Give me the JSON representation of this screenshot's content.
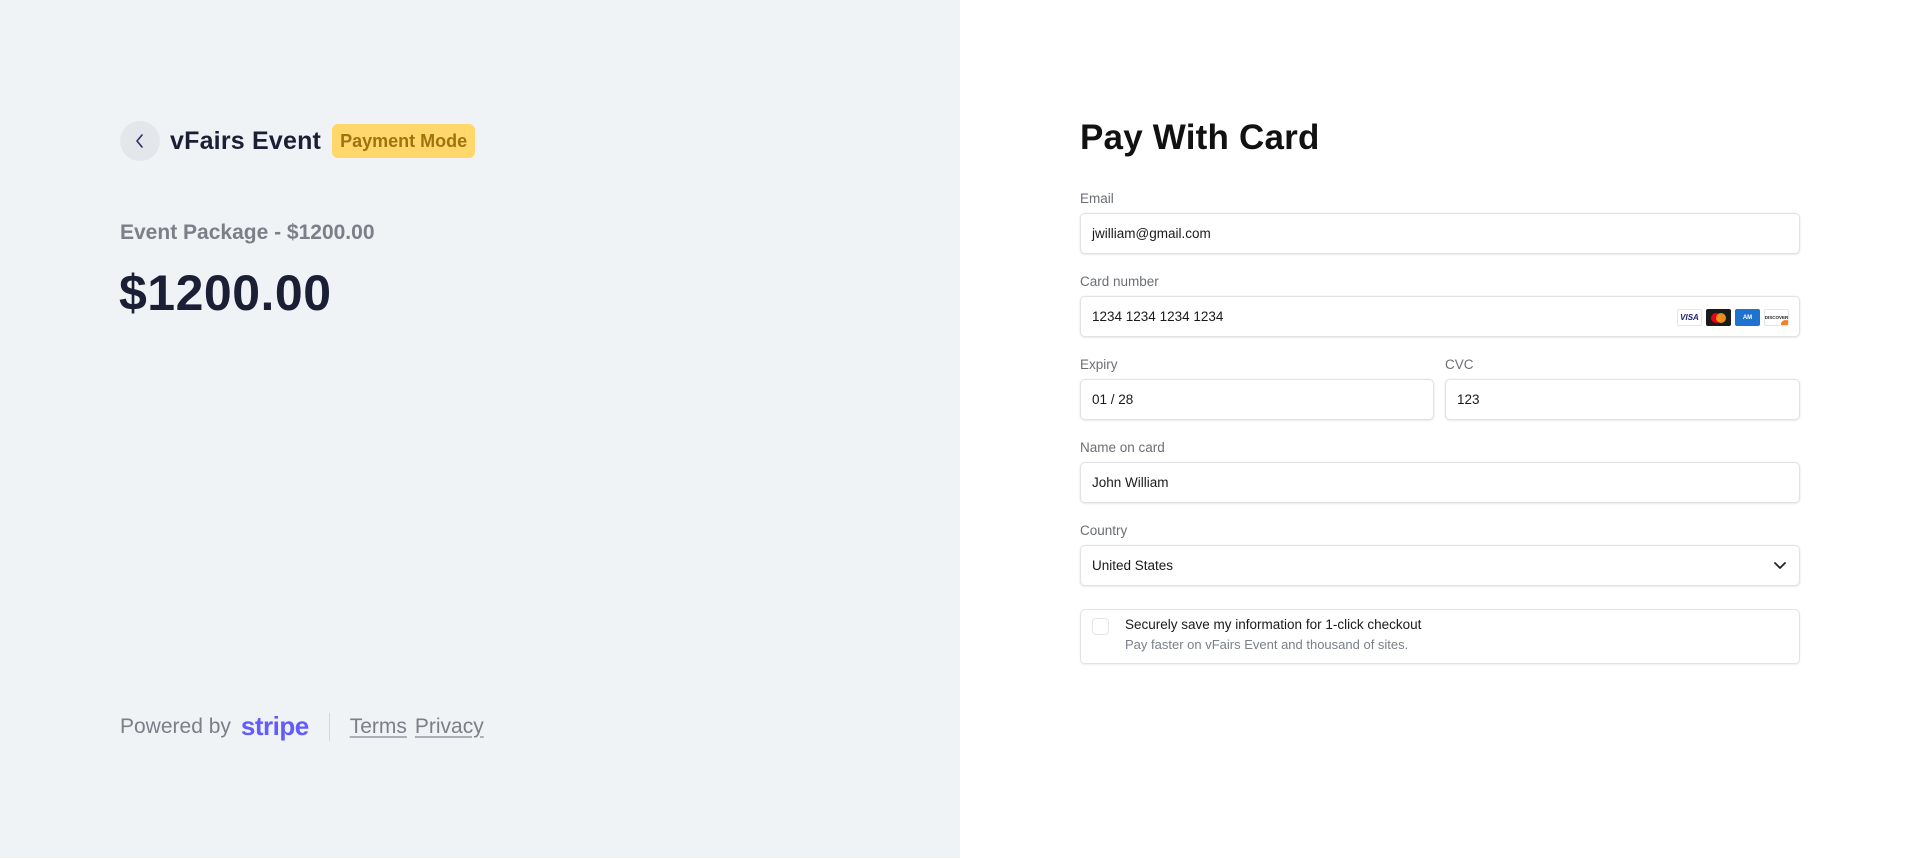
{
  "summary": {
    "back_icon": "chevron-left-icon",
    "brand_name": "vFairs Event",
    "mode_badge": "Payment Mode",
    "package_label": "Event Package - $1200.00",
    "total_amount": "$1200.00",
    "footer": {
      "powered_by": "Powered by",
      "stripe_logo": "stripe",
      "terms": "Terms",
      "privacy": "Privacy"
    },
    "colors": {
      "badge_bg": "#ffd76a",
      "badge_text": "#a07212",
      "stripe": "#635bff",
      "panel_bg": "#f0f3f6"
    }
  },
  "form": {
    "title": "Pay With Card",
    "email": {
      "label": "Email",
      "value": "jwilliam@gmail.com"
    },
    "card_number": {
      "label": "Card number",
      "value": "1234 1234 1234 1234",
      "brands": [
        "VISA",
        "Mastercard",
        "American Express",
        "Discover"
      ]
    },
    "expiry": {
      "label": "Expiry",
      "value": "01 / 28"
    },
    "cvc": {
      "label": "CVC",
      "value": "123"
    },
    "name": {
      "label": "Name on card",
      "value": "John William"
    },
    "country": {
      "label": "Country",
      "value": "United States"
    },
    "save_info": {
      "checked": false,
      "title": "Securely save my information for 1-click checkout",
      "subtitle": "Pay faster on vFairs Event and thousand of sites."
    }
  }
}
